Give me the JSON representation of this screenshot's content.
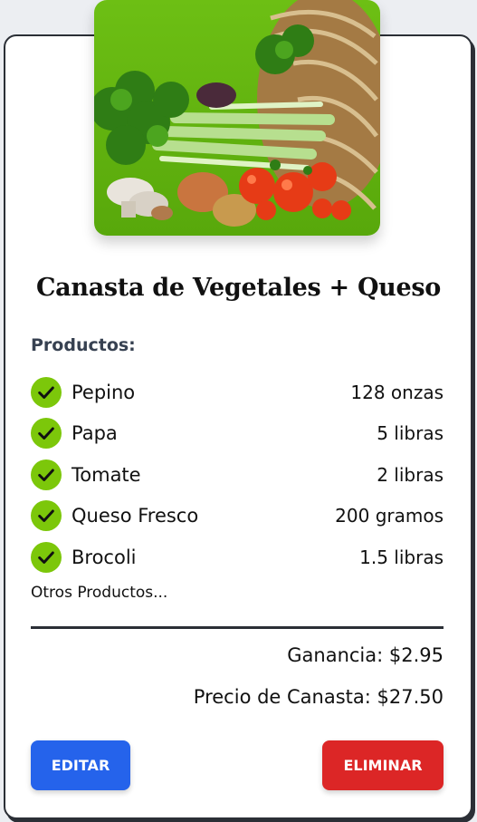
{
  "card": {
    "image_alt": "vegetable-basket",
    "title": "Canasta de Vegetales + Queso",
    "products_label": "Productos:",
    "products": [
      {
        "name": "Pepino",
        "quantity": "128 onzas"
      },
      {
        "name": "Papa",
        "quantity": "5 libras"
      },
      {
        "name": "Tomate",
        "quantity": "2 libras"
      },
      {
        "name": "Queso Fresco",
        "quantity": "200 gramos"
      },
      {
        "name": "Brocoli",
        "quantity": "1.5 libras"
      }
    ],
    "others_label": "Otros Productos...",
    "earning_label": "Ganancia: $2.95",
    "price_label": "Precio de Canasta: $27.50",
    "edit_label": "EDITAR",
    "delete_label": "ELIMINAR"
  },
  "colors": {
    "check_green": "#7cc70a",
    "edit_blue": "#2563eb",
    "delete_red": "#dc2626",
    "image_bg_green": "#6cbf12"
  },
  "icons": {
    "check": "check-circle-icon"
  }
}
